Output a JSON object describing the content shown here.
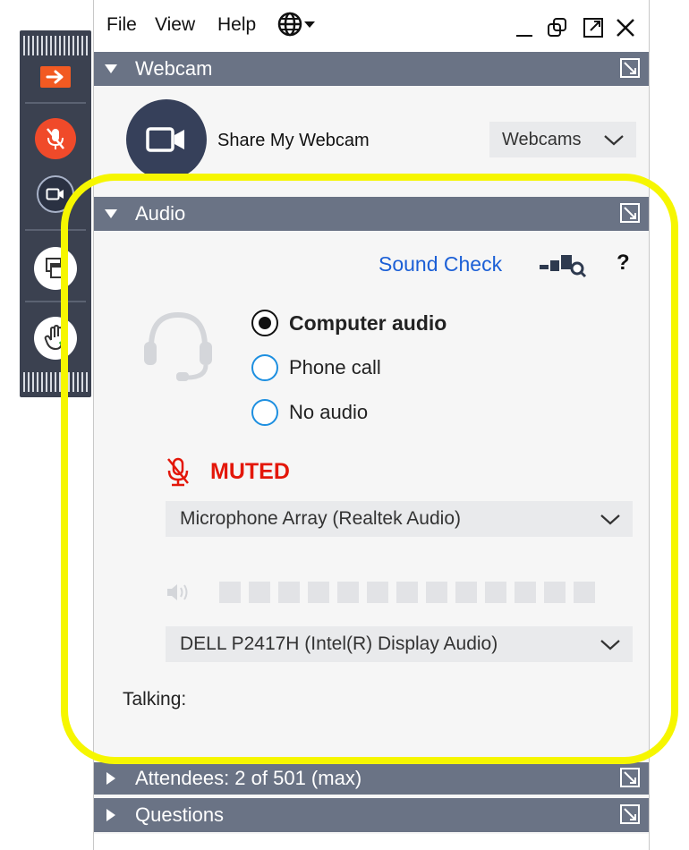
{
  "menu": {
    "file": "File",
    "view": "View",
    "help": "Help"
  },
  "webcam": {
    "section_title": "Webcam",
    "share_label": "Share My Webcam",
    "select_value": "Webcams"
  },
  "audio": {
    "section_title": "Audio",
    "sound_check": "Sound Check",
    "help": "?",
    "options": [
      {
        "label": "Computer audio",
        "selected": true
      },
      {
        "label": "Phone call",
        "selected": false
      },
      {
        "label": "No audio",
        "selected": false
      }
    ],
    "status": "MUTED",
    "microphone": "Microphone Array (Realtek Audio)",
    "speaker": "DELL P2417H (Intel(R) Display Audio)",
    "talking_label": "Talking:"
  },
  "attendees": {
    "section_title": "Attendees:  2 of 501 (max)"
  },
  "questions": {
    "section_title": "Questions"
  },
  "colors": {
    "accent_orange": "#f25a22",
    "mute_red": "#e3170a",
    "link_blue": "#1b5fd6",
    "section_bar": "#6a7385",
    "highlight_yellow": "#f6f600"
  }
}
